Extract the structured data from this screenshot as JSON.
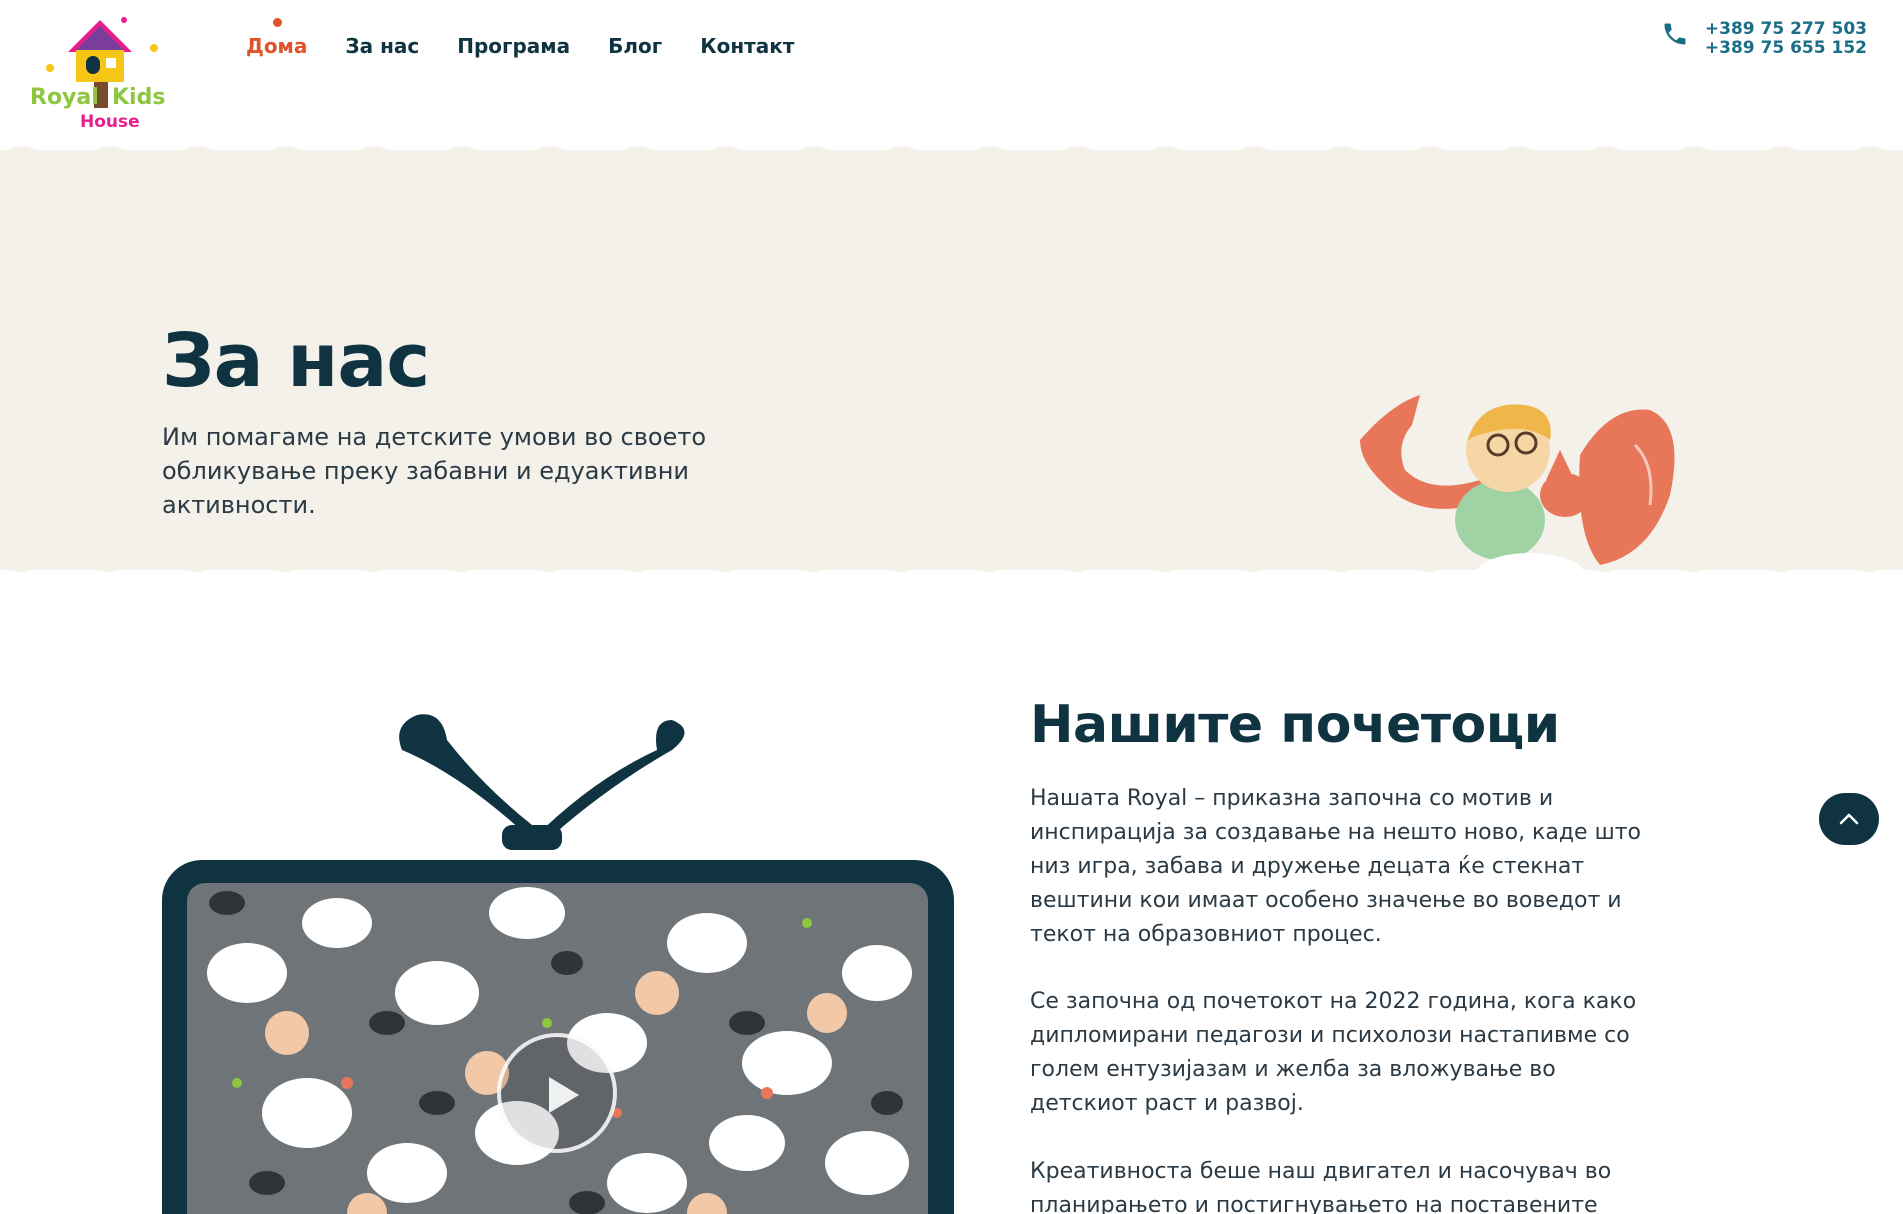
{
  "logo": {
    "word1": "Royal",
    "word2": "Kids",
    "word3": "House"
  },
  "nav": {
    "items": [
      {
        "label": "Дома",
        "active": true
      },
      {
        "label": "За нас",
        "active": false
      },
      {
        "label": "Програма",
        "active": false
      },
      {
        "label": "Блог",
        "active": false
      },
      {
        "label": "Контакт",
        "active": false
      }
    ]
  },
  "contact": {
    "phone1": "+389 75 277 503",
    "phone2": "+389 75 655 152",
    "icon": "phone-icon"
  },
  "hero": {
    "title": "За нас",
    "subtitle": "Им помагаме на детските умови во своето обликување преку забавни и едуактивни активности."
  },
  "about": {
    "title": "Нашите почетоци",
    "paragraph1": "Нашата Royal – приказна започна со мотив и инспирација за создавање на нешто ново, каде што низ игра, забава и дружење децата ќе стекнат вештини кои имаат особено значење во воведот и текот на образовниот процес.",
    "paragraph2": "Се започна од почетокот на 2022 година, кога како дипломирани педагози и психолози настапивме со голем ентузијазам и желба за вложување во детскиот раст и развој.",
    "paragraph3": "Креативноста беше наш двигател и насочувач во планирањето и постигнувањето на поставените"
  },
  "colors": {
    "primary": "#0f3340",
    "accent": "#e0532b",
    "phone": "#1a6e86",
    "hero_bg": "#f4f1ea"
  },
  "icons": {
    "play": "play-icon",
    "scroll_top": "chevron-up-icon"
  }
}
